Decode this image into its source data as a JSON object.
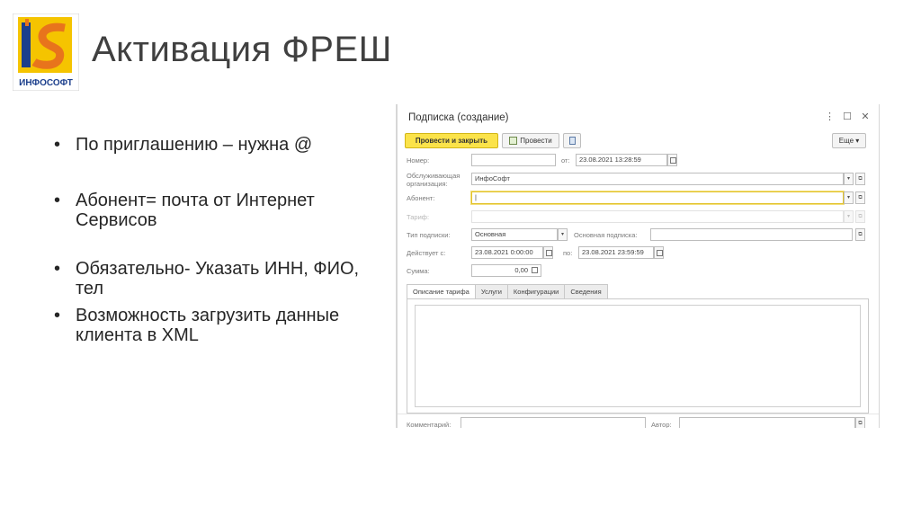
{
  "slide": {
    "title": "Активация ФРЕШ",
    "logo_text": "ИНФОСОФТ",
    "logo_letters": "IS",
    "bullets": [
      "По приглашению – нужна @",
      "Абонент= почта от Интернет Сервисов",
      "Обязательно- Указать ИНН, ФИО, тел",
      "Возможность загрузить данные клиента в XML"
    ]
  },
  "window": {
    "title": "Подписка (создание)",
    "controls": {
      "menu": "⋮",
      "maximize": "☐",
      "close": "✕"
    },
    "toolbar": {
      "post_close": "Провести и закрыть",
      "post": "Провести",
      "more": "Еще ▾"
    },
    "form": {
      "number_label": "Номер:",
      "number_value": "",
      "from_label": "от:",
      "from_value": "23.08.2021 13:28:59",
      "org_label": "Обслуживающая организация:",
      "org_value": "ИнфоСофт",
      "subscriber_label": "Абонент:",
      "subscriber_value": "|",
      "tariff_label": "Тариф:",
      "tariff_value": "",
      "type_label": "Тип подписки:",
      "type_value": "Основная",
      "main_sub_label": "Основная подписка:",
      "main_sub_value": "",
      "valid_label": "Действует с:",
      "valid_from": "23.08.2021  0:00:00",
      "to_label": "по:",
      "valid_to": "23.08.2021 23:59:59",
      "sum_label": "Сумма:",
      "sum_value": "0,00",
      "comment_label": "Комментарий:",
      "comment_value": "",
      "author_label": "Автор:",
      "author_value": ""
    },
    "tabs": [
      "Описание тарифа",
      "Услуги",
      "Конфигурации",
      "Сведения"
    ]
  },
  "colors": {
    "primary_button": "#fbe34a",
    "focus_border": "#e2c22b",
    "logo_yellow": "#f5c400",
    "logo_orange": "#e8741c",
    "logo_blue": "#1c3f8c"
  }
}
